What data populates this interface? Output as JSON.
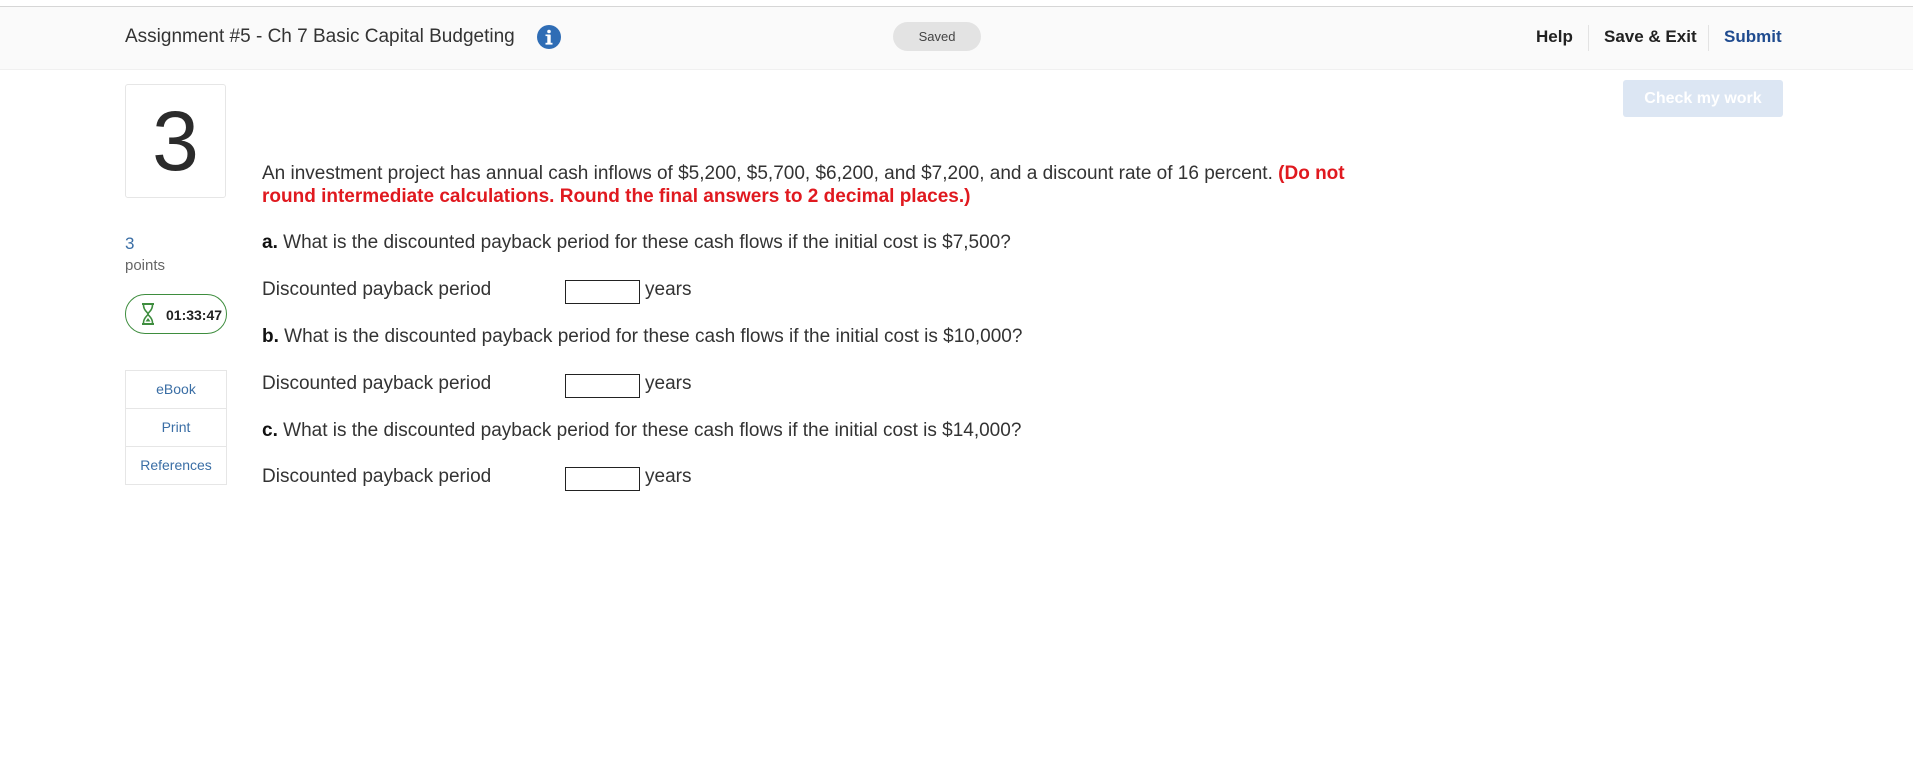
{
  "header": {
    "assignment_title": "Assignment #5 - Ch 7 Basic Capital Budgeting",
    "saved_status": "Saved",
    "help_label": "Help",
    "save_exit_label": "Save & Exit",
    "submit_label": "Submit",
    "info_icon": "info-icon",
    "accent_color": "#1f4b8f"
  },
  "toolbar": {
    "check_my_work_label": "Check my work"
  },
  "sidebar": {
    "question_number": "3",
    "points_value": "3",
    "points_label": "points",
    "timer": "01:33:47",
    "timer_icon": "hourglass-icon",
    "links": [
      {
        "label": "eBook"
      },
      {
        "label": "Print"
      },
      {
        "label": "References"
      }
    ]
  },
  "question": {
    "intro": "An investment project has annual cash inflows of $5,200, $5,700, $6,200, and $7,200, and a discount rate of 16 percent.",
    "instructions": "(Do not round intermediate calculations. Round the final answers to 2 decimal places.)",
    "warning_color": "#e0191f",
    "parts": [
      {
        "letter": "a.",
        "text": "What is the discounted payback period for these cash flows if the initial cost is $7,500?",
        "answer_label": "Discounted payback period",
        "answer_value": "",
        "unit": "years"
      },
      {
        "letter": "b.",
        "text": "What is the discounted payback period for these cash flows if the initial cost is $10,000?",
        "answer_label": "Discounted payback period",
        "answer_value": "",
        "unit": "years"
      },
      {
        "letter": "c.",
        "text": "What is the discounted payback period for these cash flows if the initial cost is $14,000?",
        "answer_label": "Discounted payback period",
        "answer_value": "",
        "unit": "years"
      }
    ]
  }
}
